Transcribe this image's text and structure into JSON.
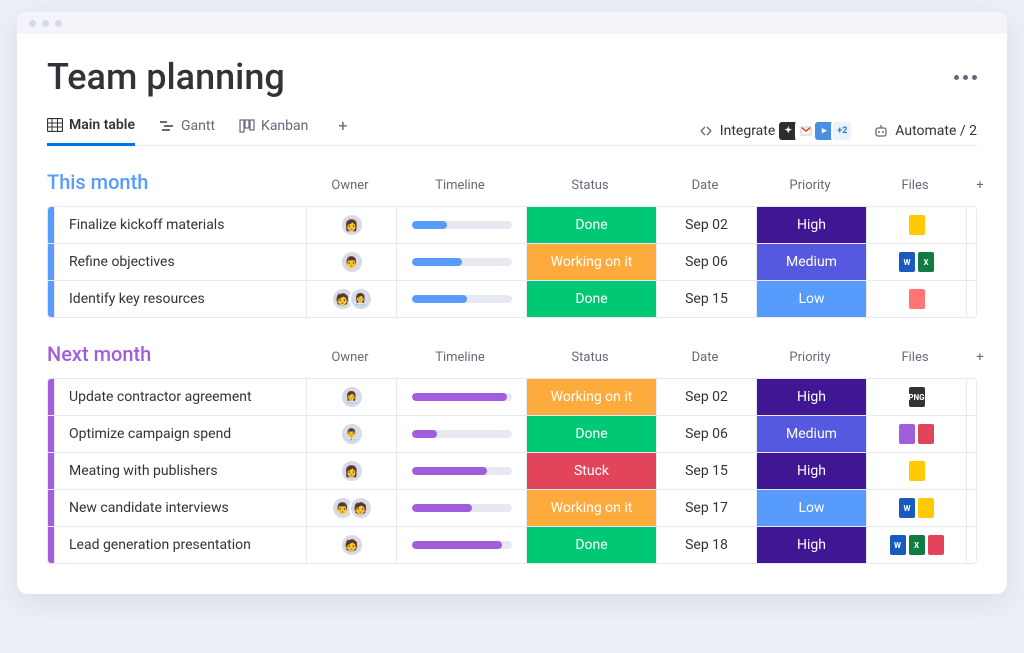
{
  "page_title": "Team planning",
  "tabs": {
    "main_table": "Main table",
    "gantt": "Gantt",
    "kanban": "Kanban"
  },
  "toolbar": {
    "integrate": "Integrate",
    "integrate_more": "+2",
    "automate": "Automate / 2"
  },
  "columns": {
    "owner": "Owner",
    "timeline": "Timeline",
    "status": "Status",
    "date": "Date",
    "priority": "Priority",
    "files": "Files"
  },
  "groups": [
    {
      "title": "This month",
      "color": "blue",
      "rows": [
        {
          "name": "Finalize kickoff materials",
          "owner_count": 1,
          "timeline_pct": 35,
          "status": "Done",
          "status_class": "status-done",
          "date": "Sep 02",
          "priority": "High",
          "priority_class": "prio-high",
          "files": [
            "fi-yellow"
          ]
        },
        {
          "name": "Refine objectives",
          "owner_count": 1,
          "timeline_pct": 50,
          "status": "Working on it",
          "status_class": "status-working",
          "date": "Sep 06",
          "priority": "Medium",
          "priority_class": "prio-medium",
          "files": [
            "fi-word",
            "fi-excel"
          ]
        },
        {
          "name": "Identify key resources",
          "owner_count": 2,
          "timeline_pct": 55,
          "status": "Done",
          "status_class": "status-done",
          "date": "Sep 15",
          "priority": "Low",
          "priority_class": "prio-low",
          "files": [
            "fi-pink"
          ]
        }
      ]
    },
    {
      "title": "Next month",
      "color": "purple",
      "rows": [
        {
          "name": "Update contractor agreement",
          "owner_count": 1,
          "timeline_pct": 95,
          "status": "Working on it",
          "status_class": "status-working",
          "date": "Sep 02",
          "priority": "High",
          "priority_class": "prio-high",
          "files": [
            "fi-png"
          ]
        },
        {
          "name": "Optimize campaign spend",
          "owner_count": 1,
          "timeline_pct": 25,
          "status": "Done",
          "status_class": "status-done",
          "date": "Sep 06",
          "priority": "Medium",
          "priority_class": "prio-medium",
          "files": [
            "fi-purple",
            "fi-red"
          ]
        },
        {
          "name": "Meating with publishers",
          "owner_count": 1,
          "timeline_pct": 75,
          "status": "Stuck",
          "status_class": "status-stuck",
          "date": "Sep 15",
          "priority": "High",
          "priority_class": "prio-high",
          "files": [
            "fi-yellow"
          ]
        },
        {
          "name": "New candidate interviews",
          "owner_count": 2,
          "timeline_pct": 60,
          "status": "Working on it",
          "status_class": "status-working",
          "date": "Sep 17",
          "priority": "Low",
          "priority_class": "prio-low",
          "files": [
            "fi-word",
            "fi-yellow"
          ]
        },
        {
          "name": "Lead generation presentation",
          "owner_count": 1,
          "timeline_pct": 90,
          "status": "Done",
          "status_class": "status-done",
          "date": "Sep 18",
          "priority": "High",
          "priority_class": "prio-high",
          "files": [
            "fi-word",
            "fi-excel",
            "fi-red"
          ]
        }
      ]
    }
  ]
}
